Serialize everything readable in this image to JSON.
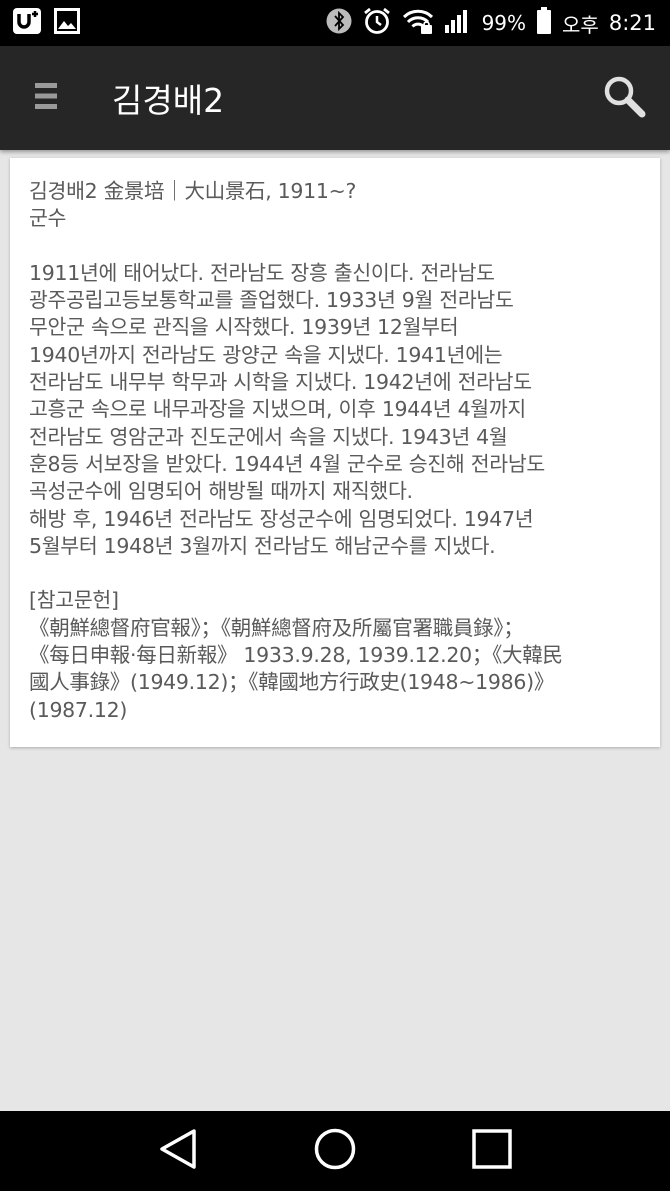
{
  "status_bar": {
    "battery_percent": "99%",
    "ampm": "오후",
    "time": "8:21",
    "icons": [
      "u-plus-icon",
      "gallery-icon",
      "bluetooth-icon",
      "alarm-icon",
      "wifi-icon",
      "signal-icon",
      "battery-icon"
    ]
  },
  "app_bar": {
    "title": "김경배2",
    "menu_icon": "menu-icon",
    "search_icon": "search-icon"
  },
  "card": {
    "heading": "김경배2 金景培｜大山景石, 1911~?",
    "role": "군수",
    "body_lines": [
      "1911년에 태어났다. 전라남도 장흥 출신이다. 전라남도",
      "광주공립고등보통학교를 졸업했다. 1933년 9월 전라남도",
      "무안군 속으로 관직을 시작했다. 1939년 12월부터",
      "1940년까지 전라남도 광양군 속을 지냈다. 1941년에는",
      "전라남도 내무부 학무과 시학을 지냈다. 1942년에 전라남도",
      "고흥군 속으로 내무과장을 지냈으며, 이후 1944년 4월까지",
      "전라남도 영암군과 진도군에서 속을 지냈다. 1943년 4월",
      "훈8등 서보장을 받았다. 1944년 4월 군수로 승진해 전라남도",
      "곡성군수에 임명되어 해방될 때까지 재직했다.",
      "해방 후, 1946년 전라남도 장성군수에 임명되었다. 1947년",
      "5월부터 1948년 3월까지 전라남도 해남군수를 지냈다."
    ],
    "refs_title": "[참고문헌]",
    "refs_lines": [
      "《朝鮮總督府官報》；《朝鮮總督府及所屬官署職員錄》；",
      "《每日申報·每日新報》 1933.9.28, 1939.12.20；《大韓民",
      "國人事錄》(1949.12)；《韓國地方行政史(1948~1986)》",
      "(1987.12)"
    ]
  },
  "nav_bar": {
    "icons": [
      "back-icon",
      "home-icon",
      "recents-icon"
    ]
  }
}
